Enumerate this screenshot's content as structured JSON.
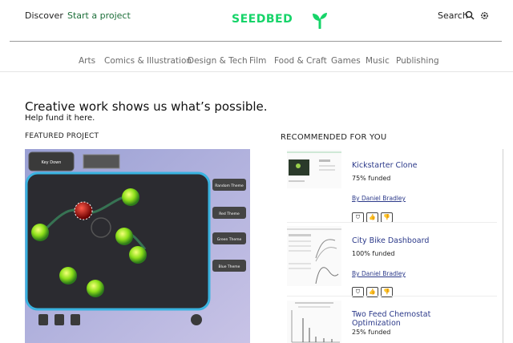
{
  "header": {
    "discover_label": "Discover",
    "start_label": "Start a project",
    "logo_text": "SEEDBED",
    "search_label": "Search",
    "icons": [
      "search-icon",
      "gear-icon",
      "sprout-icon"
    ]
  },
  "categories": [
    "Arts",
    "Comics & Illustration",
    "Design & Tech",
    "Film",
    "Food & Craft",
    "Games",
    "Music",
    "Publishing"
  ],
  "hero": {
    "title": "Creative work shows us what’s possible.",
    "subtitle": "Help fund it here."
  },
  "featured": {
    "label": "FEATURED PROJECT",
    "buttons": {
      "top_button": "Key Down",
      "theme_buttons": [
        "Random Theme",
        "Red Theme",
        "Green Theme",
        "Blue Theme"
      ]
    }
  },
  "recommended": {
    "label": "RECOMMENDED FOR YOU",
    "items": [
      {
        "title": "Kickstarter Clone",
        "funded": "75% funded",
        "author": "By Daniel Bradley"
      },
      {
        "title": "City Bike Dashboard",
        "funded": "100% funded",
        "author": "By Daniel Bradley"
      },
      {
        "title": "Two Feed Chemostat Optimization",
        "funded": "25% funded",
        "author": ""
      }
    ]
  },
  "colors": {
    "brand": "#16d469",
    "start_link": "#1d6f3a",
    "link": "#2c3a8a"
  }
}
